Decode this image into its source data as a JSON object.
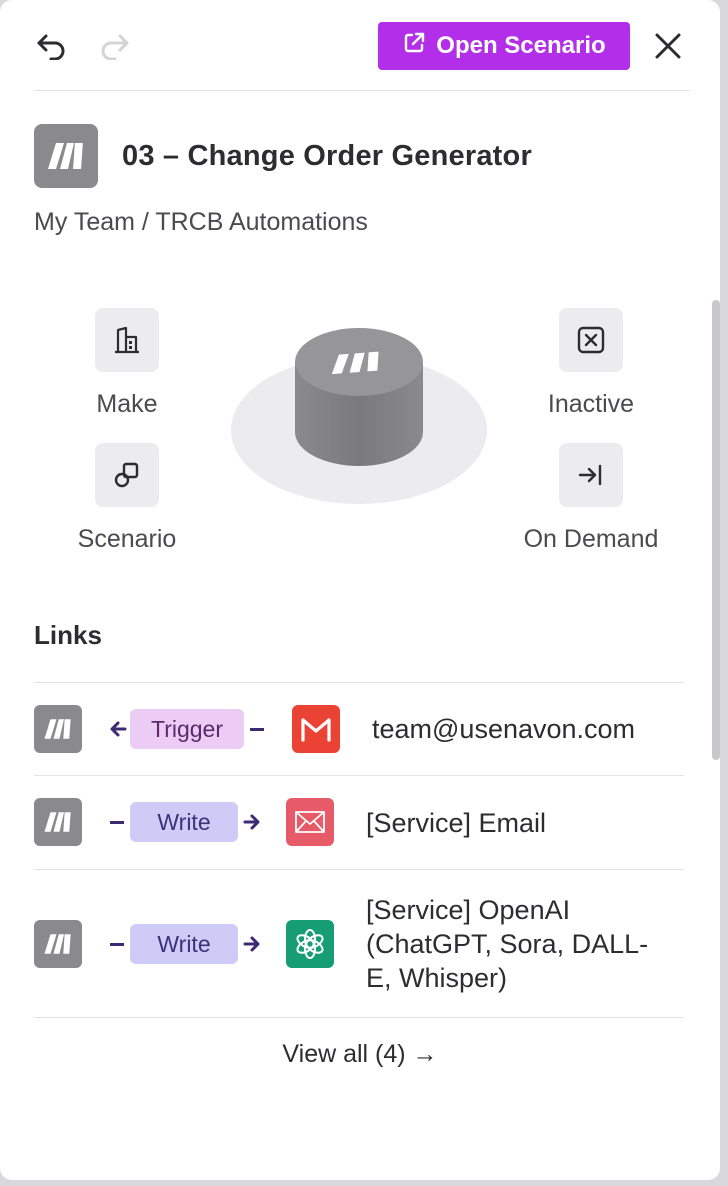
{
  "toolbar": {
    "undo_icon": "undo-icon",
    "redo_icon": "redo-icon",
    "open_scenario_label": "Open Scenario",
    "close_icon": "close-icon"
  },
  "header": {
    "title": "03 – Change Order Generator",
    "breadcrumb": "My Team / TRCB Automations"
  },
  "properties": {
    "platform": {
      "label": "Make",
      "icon": "building-icon"
    },
    "type": {
      "label": "Scenario",
      "icon": "copy-icon"
    },
    "status": {
      "label": "Inactive",
      "icon": "x-box-icon"
    },
    "schedule": {
      "label": "On Demand",
      "icon": "arrow-in-icon"
    }
  },
  "links": {
    "heading": "Links",
    "items": [
      {
        "relation": "Trigger",
        "direction": "incoming",
        "service": "team@usenavon.com",
        "service_icon": "gmail-icon",
        "service_color": "#ea4335"
      },
      {
        "relation": "Write",
        "direction": "outgoing",
        "service": "[Service] Email",
        "service_icon": "envelope-icon",
        "service_color": "#e75a68"
      },
      {
        "relation": "Write",
        "direction": "outgoing",
        "service_line1": "[Service] OpenAI",
        "service_line2": "(ChatGPT, Sora, DALL-",
        "service_line3": "E, Whisper)",
        "service_icon": "openai-icon",
        "service_color": "#169d74"
      }
    ],
    "view_all": "View all (4) →"
  },
  "colors": {
    "accent": "#b22ee8",
    "trigger_pill": "#ecccf5",
    "write_pill": "#cfcbf6"
  }
}
